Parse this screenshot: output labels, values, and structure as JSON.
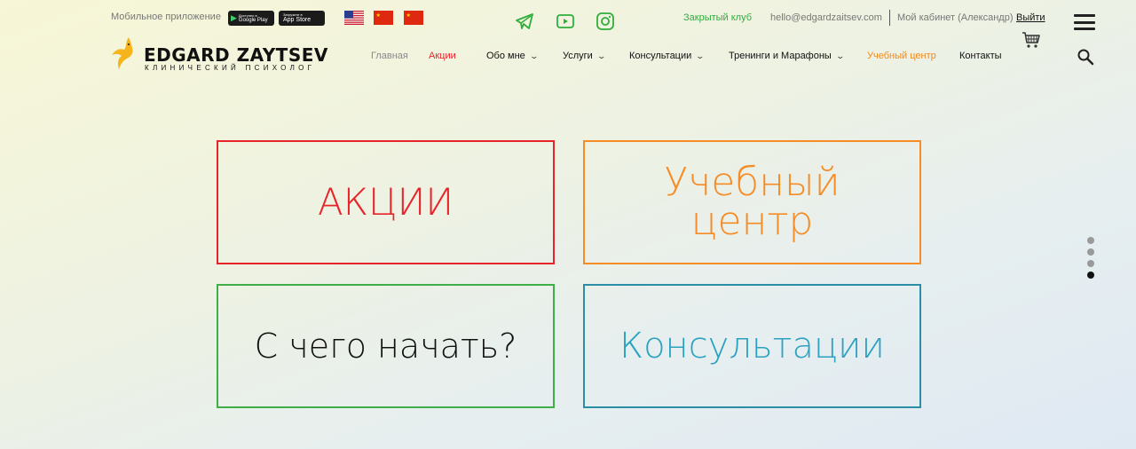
{
  "topbar": {
    "app_label": "Мобильное приложение",
    "google_play": {
      "small": "Доступно в",
      "name": "Google Play"
    },
    "app_store": {
      "small": "Загрузите в",
      "name": "App Store"
    },
    "languages": [
      "us-flag-icon",
      "cn-flag-icon",
      "cn-flag-icon"
    ],
    "social": [
      "telegram-icon",
      "youtube-icon",
      "instagram-icon"
    ],
    "club": "Закрытый клуб",
    "email": "hello@edgardzaitsev.com",
    "cabinet": "Мой кабинет (Александр)",
    "logout": "Выйти"
  },
  "logo": {
    "title": "EDGARD ZAYTSEV",
    "subtitle": "Клинический психолог"
  },
  "nav": [
    {
      "label": "Главная"
    },
    {
      "label": "Акции"
    },
    {
      "label": "Обо мне",
      "chev": "⌄"
    },
    {
      "label": "Услуги",
      "chev": "⌄"
    },
    {
      "label": "Консультации",
      "chev": "⌄"
    },
    {
      "label": "Тренинги и Марафоны",
      "chev": "⌄"
    },
    {
      "label": "Учебный центр"
    },
    {
      "label": "Контакты"
    }
  ],
  "tiles": {
    "promo": "АКЦИИ",
    "edu_line1": "Учебный",
    "edu_line2": "центр",
    "start": "С чего начать?",
    "consult": "Консультации"
  },
  "colors": {
    "promo": "#e8242b",
    "edu": "#f58c26",
    "start_border": "#3fae49",
    "consult": "#2aa2c0",
    "club": "#2fae3c"
  },
  "pager": {
    "total": 4,
    "active_index": 3
  }
}
